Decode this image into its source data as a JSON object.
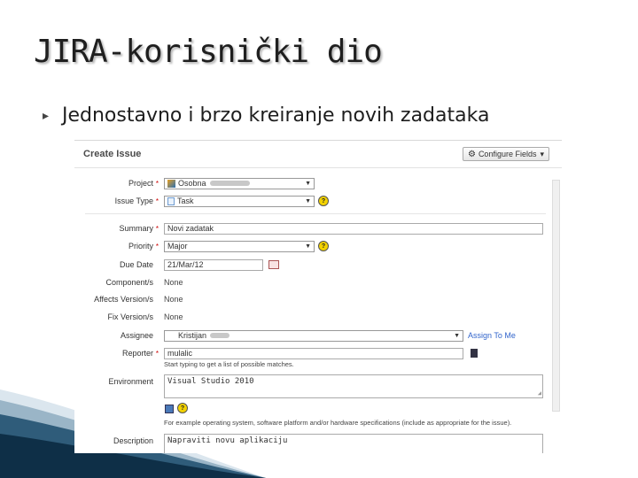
{
  "slide": {
    "title": "JIRA-korisnički dio",
    "bullet": "Jednostavno i brzo kreiranje novih zadataka"
  },
  "dialog": {
    "title": "Create Issue",
    "configure_label": "Configure Fields",
    "configure_arrow": "▾",
    "fields": {
      "project": {
        "label": "Project",
        "value": "Osobna"
      },
      "issue_type": {
        "label": "Issue Type",
        "value": "Task"
      },
      "summary": {
        "label": "Summary",
        "value": "Novi zadatak"
      },
      "priority": {
        "label": "Priority",
        "value": "Major"
      },
      "due_date": {
        "label": "Due Date",
        "value": "21/Mar/12"
      },
      "components": {
        "label": "Component/s",
        "value": "None"
      },
      "affects_versions": {
        "label": "Affects Version/s",
        "value": "None"
      },
      "fix_versions": {
        "label": "Fix Version/s",
        "value": "None"
      },
      "assignee": {
        "label": "Assignee",
        "value": "Kristijan",
        "link": "Assign To Me"
      },
      "reporter": {
        "label": "Reporter",
        "value": "mulalic",
        "hint": "Start typing to get a list of possible matches."
      },
      "environment": {
        "label": "Environment",
        "value": "Visual Studio 2010",
        "hint": "For example operating system, software platform and/or hardware specifications (include as appropriate for the issue)."
      },
      "description": {
        "label": "Description",
        "value": "Napraviti novu aplikaciju"
      }
    }
  },
  "colors": {
    "link": "#3366cc",
    "required": "#cc0000",
    "help": "#f3d200"
  }
}
